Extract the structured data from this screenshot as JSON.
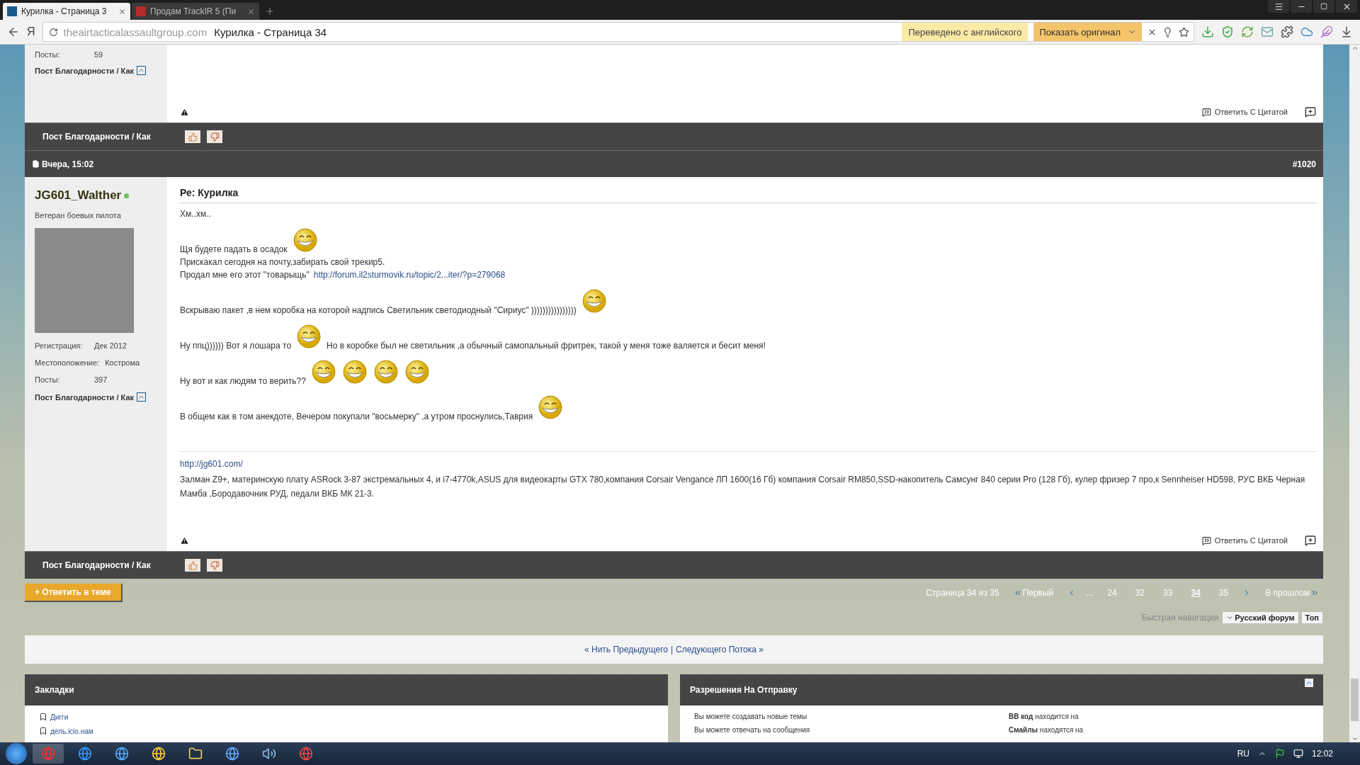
{
  "browser": {
    "tabs": [
      {
        "title": "Курилка - Страница 3",
        "selected": true
      },
      {
        "title": "Продам TrackIR 5 (Пи",
        "selected": false
      }
    ],
    "logo_letter": "Я",
    "address": {
      "domain": "theairtacticalassaultgroup.com",
      "title": "Курилка - Страница 34"
    },
    "translate": {
      "label": "Переведено с английского",
      "button": "Показать оригинал"
    }
  },
  "previous_post": {
    "stats": [
      {
        "label": "Посты:",
        "value": "59"
      }
    ],
    "thanks_link": "Пост Благодарности / Как",
    "reply_quote": "Ответить С Цитатой",
    "thanks_bar": "Пост Благодарности / Как"
  },
  "post": {
    "date": "Вчера, 15:02",
    "number": "#1020",
    "author": {
      "name": "JG601_Walther",
      "online": true,
      "rank": "Ветеран боевых пилота",
      "stats": [
        {
          "label": "Регистрация:",
          "value": "Дек 2012"
        },
        {
          "label": "Местоположение:",
          "value": "Кострома"
        },
        {
          "label": "Посты:",
          "value": "397"
        }
      ],
      "thanks_link": "Пост Благодарности / Как"
    },
    "title": "Ре: Курилка",
    "paragraphs": [
      [
        [
          {
            "kind": "text",
            "text": "Хм..хм.."
          }
        ]
      ],
      [
        [
          {
            "kind": "text",
            "text": "Щя будете падать в осадок"
          },
          {
            "kind": "smiley"
          }
        ],
        [
          {
            "kind": "text",
            "text": "Прискакал сегодня на почту,забирать свой трекир5."
          }
        ],
        [
          {
            "kind": "text",
            "text": "Продал мне его этот \"товарыщь\""
          },
          {
            "kind": "link",
            "text": "http://forum.il2sturmovik.ru/topic/2...iter/?p=279068"
          }
        ]
      ],
      [
        [
          {
            "kind": "text",
            "text": "Вскрываю пакет ,в нем коробка на которой надпись Светильник светодиодный \"Сириус\" ))))))))))))))))"
          },
          {
            "kind": "smiley"
          }
        ]
      ],
      [
        [
          {
            "kind": "text",
            "text": "Ну ппц)))))) Вот я лошара то"
          },
          {
            "kind": "smiley"
          },
          {
            "kind": "text",
            "text": "Но в коробке был не светильник ,а обычный самопальный фритрек, такой у меня тоже валяется и бесит меня!"
          }
        ]
      ],
      [
        [
          {
            "kind": "text",
            "text": "Ну вот и как людям то верить??"
          },
          {
            "kind": "smiley"
          },
          {
            "kind": "smiley"
          },
          {
            "kind": "smiley"
          },
          {
            "kind": "smiley"
          }
        ]
      ],
      [
        [
          {
            "kind": "text",
            "text": "В общем как в том анекдоте, Вечером покупали \"восьмерку\" ,а утром проснулись,Таврия"
          },
          {
            "kind": "smiley"
          }
        ]
      ]
    ],
    "signature": {
      "link": "http://jg601.com/",
      "text": "Залман Z9+, материнскую плату ASRock 3-87 экстремальных 4, и i7-4770k,ASUS для видеокарты GTX 780,компания Corsair Vengance ЛП 1600(16 Гб) компания Corsair RM850,SSD-накопитель Самсунг 840 серии Pro (128 Гб), кулер фризер 7 про,к Sennheiser HD598, РУС ВКБ Черная Мамба ,Бородавочник РУД, педали ВКБ МК 21-3."
    },
    "reply_quote": "Ответить С Цитатой",
    "thanks_bar": "Пост Благодарности / Как"
  },
  "pagination": {
    "reply_button": "+ Ответить в теме",
    "summary": "Страница 34 из 35",
    "first": "Первый",
    "ellipsis": "...",
    "pages": [
      {
        "label": "24",
        "selected": false
      },
      {
        "label": "32",
        "selected": false
      },
      {
        "label": "33",
        "selected": false
      },
      {
        "label": "34",
        "selected": true
      },
      {
        "label": "35",
        "selected": false
      }
    ],
    "last": "В прошлом"
  },
  "quick_nav": {
    "label": "Быстрая навигация",
    "forum": "Русский форум",
    "top": "Топ"
  },
  "thread_nav": {
    "previous": "« Нить Предыдущего",
    "separator": "|",
    "next": "Следующего Потока »"
  },
  "bookmarks": {
    "title": "Закладки",
    "items": [
      "Дигги",
      "дель.icio.нам"
    ]
  },
  "permissions": {
    "title": "Разрешения На Отправку",
    "left": [
      "Вы можете создавать новые темы",
      "Вы можете отвечать на сообщения"
    ],
    "right": [
      "**BB код** находится на",
      "**Смайлы** находятся на"
    ]
  },
  "taskbar": {
    "language": "RU",
    "time": "12:02"
  }
}
